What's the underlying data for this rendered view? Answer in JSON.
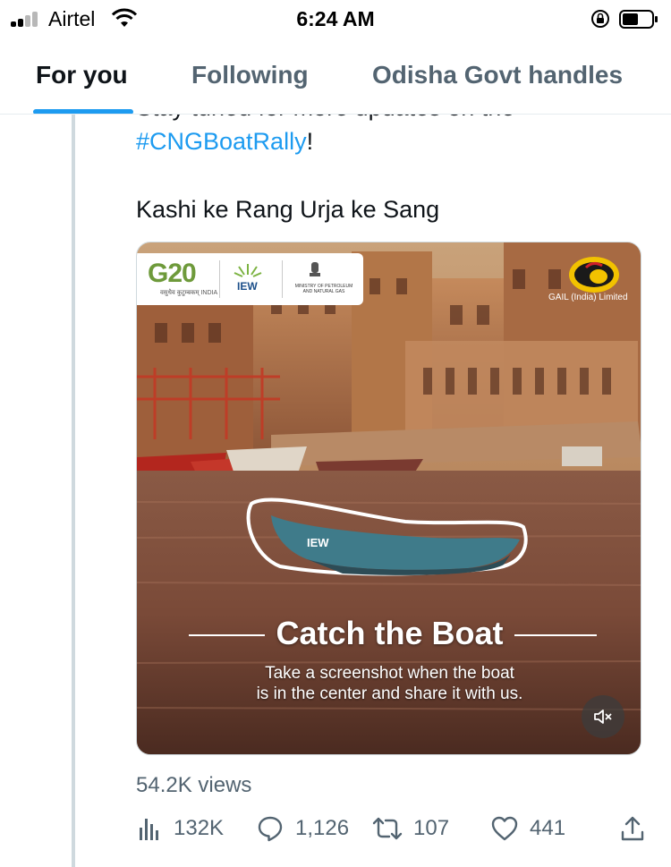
{
  "status_bar": {
    "carrier": "Airtel",
    "time": "6:24 AM",
    "icons": [
      "signal-icon",
      "wifi-icon",
      "orientation-lock-icon",
      "battery-icon"
    ]
  },
  "tabs": [
    {
      "label": "For you",
      "active": true
    },
    {
      "label": "Following",
      "active": false
    },
    {
      "label": "Odisha Govt handles",
      "active": false
    }
  ],
  "tweet": {
    "cut_text": "Stay tuned for more updates on the",
    "hashtag": "#CNGBoatRally",
    "hashtag_suffix": "!",
    "line2": "Kashi ke Rang Urja ke Sang"
  },
  "media": {
    "logos": {
      "g20": "G20",
      "g20_sub": "वसुधैव कुटुम्बकम् INDIA",
      "iew": "IEW",
      "ministry": "MINISTRY OF PETROLEUM AND NATURAL GAS",
      "gail": "GAIL (India) Limited"
    },
    "boat_logo": "IEW",
    "headline": "Catch the Boat",
    "subtext_line1": "Take a screenshot when the boat",
    "subtext_line2": "is in the center and share it with us.",
    "mute_icon": "speaker-muted-icon"
  },
  "stats": {
    "views": "54.2K views",
    "analytics": "132K",
    "replies": "1,126",
    "retweets": "107",
    "likes": "441"
  },
  "colors": {
    "accent": "#1d9bf0",
    "secondary_text": "#536471",
    "thread_line": "#cfd9de"
  }
}
